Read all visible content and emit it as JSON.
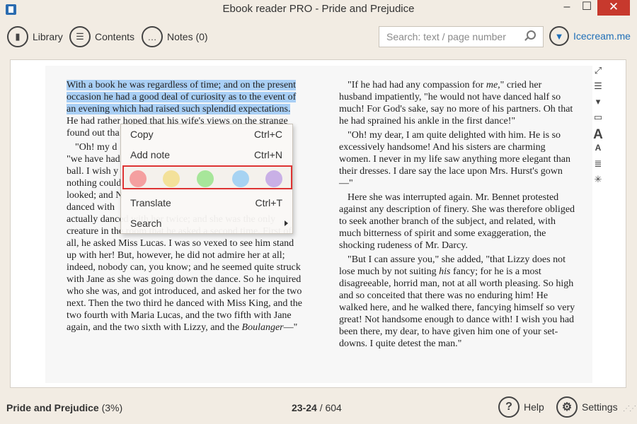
{
  "window": {
    "title": "Ebook reader PRO - Pride and Prejudice",
    "minimize": "–",
    "maximize": "☐",
    "close": "✕"
  },
  "toolbar": {
    "library": "Library",
    "contents": "Contents",
    "notes": "Notes (0)",
    "brand": "Icecream.me"
  },
  "search": {
    "placeholder": "Search: text / page number"
  },
  "book": {
    "left_column": {
      "p1_highlight": "With a book he was regardless of time; and on the present occasion he had a good deal of curiosity as to the event of an evening which had raised such splendid expectations.",
      "p1_rest": " He had rather hoped that his wife's views on the strange",
      "p1_tail": "found out tha",
      "p2_line1": "\"Oh! my d",
      "p2_line2": "\"we have had",
      "p2_line3": "ball. I wish y",
      "p2_line4": "nothing could",
      "p2_line5": "looked; and N",
      "p2_line6": "danced with",
      "p2_line7": "actually danced with her twice; and she was the only",
      "p2_rest": "creature in the room that he asked a second time. First of all, he asked Miss Lucas. I was so vexed to see him stand up with her! But, however, he did not admire her at all; indeed, nobody can, you know; and he seemed quite struck with Jane as she was going down the dance. So he inquired who she was, and got introduced, and asked her for the two next. Then the two third he danced with Miss King, and the two fourth with Maria Lucas, and the two fifth with Jane again, and the two sixth with Lizzy, and the ",
      "p2_em": "Boulanger",
      "p2_end": "—\""
    },
    "right_column": {
      "p1_a": "\"If he had had any compassion for ",
      "p1_em": "me,",
      "p1_b": "\" cried her husband impatiently, \"he would not have danced half so much! For God's sake, say no more of his partners. Oh that he had sprained his ankle in the first dance!\"",
      "p2": "\"Oh! my dear, I am quite delighted with him. He is so excessively handsome! And his sisters are charming women. I never in my life saw anything more elegant than their dresses. I dare say the lace upon Mrs. Hurst's gown—\"",
      "p3": "Here she was interrupted again. Mr. Bennet protested against any description of finery. She was therefore obliged to seek another branch of the subject, and related, with much bitterness of spirit and some exaggeration, the shocking rudeness of Mr. Darcy.",
      "p4_a": "\"But I can assure you,\" she added, \"that Lizzy does not lose much by not suiting ",
      "p4_em": "his",
      "p4_b": " fancy; for he is a most disagreeable, horrid man, not at all worth pleasing. So high and so conceited that there was no enduring him! He walked here, and he walked there, fancying himself so very great! Not handsome enough to dance with! I wish you had been there, my dear, to have given him one of your set-downs. I quite detest the man.\""
    }
  },
  "context_menu": {
    "copy": "Copy",
    "copy_shortcut": "Ctrl+C",
    "add_note": "Add note",
    "add_note_shortcut": "Ctrl+N",
    "translate": "Translate",
    "translate_shortcut": "Ctrl+T",
    "search": "Search",
    "highlight_colors": [
      "#f4a0a0",
      "#f3e19a",
      "#a7e69a",
      "#a7d3f2",
      "#c9b0e6"
    ]
  },
  "status": {
    "book_title": "Pride and Prejudice",
    "progress": "(3%)",
    "pages_current": "23-24",
    "pages_total": " / 604",
    "help": "Help",
    "settings": "Settings"
  },
  "side_tools": [
    "fullscreen-icon",
    "list-icon",
    "bookmark-icon",
    "comment-icon",
    "font-larger-icon",
    "font-smaller-icon",
    "justify-icon",
    "brightness-icon"
  ]
}
